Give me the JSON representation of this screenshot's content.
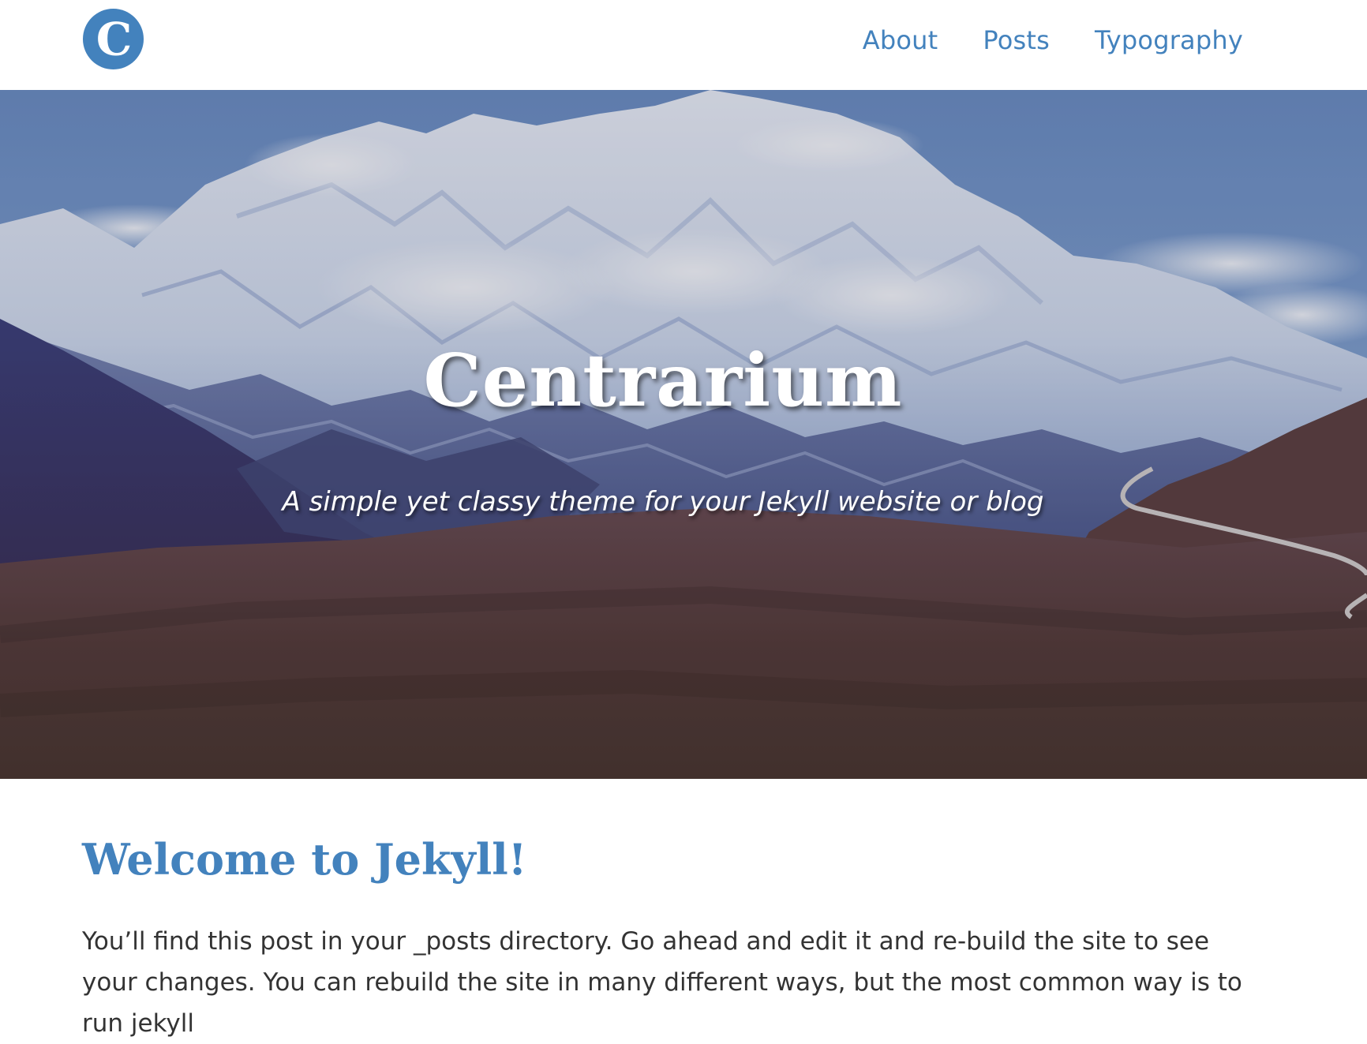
{
  "header": {
    "logo_letter": "C",
    "nav": [
      {
        "label": "About"
      },
      {
        "label": "Posts"
      },
      {
        "label": "Typography"
      }
    ]
  },
  "hero": {
    "title": "Centrarium",
    "subtitle": "A simple yet classy theme for your Jekyll website or blog"
  },
  "post": {
    "title": "Welcome to Jekyll!",
    "excerpt": "You’ll find this post in your _posts directory. Go ahead and edit it and re-build the site to see your changes. You can rebuild the site in many different ways, but the most common way is to run jekyll"
  },
  "colors": {
    "accent": "#4382bd",
    "text": "#333333",
    "background": "#ffffff"
  }
}
